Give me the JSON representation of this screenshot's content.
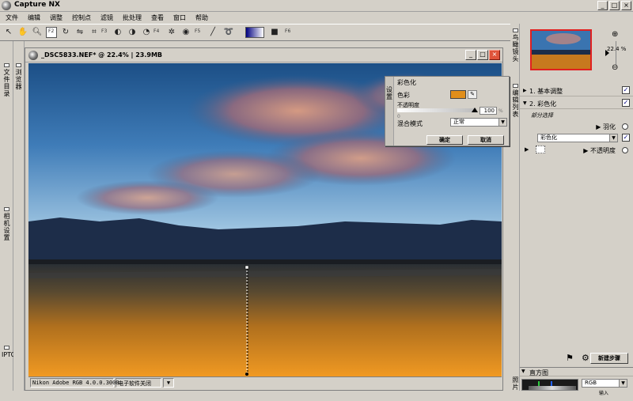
{
  "app": {
    "title": "Capture NX"
  },
  "window_buttons": [
    "_",
    "□",
    "×"
  ],
  "menu": [
    "文件",
    "编辑",
    "调整",
    "控制点",
    "滤镜",
    "批处理",
    "查看",
    "窗口",
    "帮助"
  ],
  "toolbar": {
    "fkeys": [
      "F2",
      "F3",
      "F4",
      "F5",
      "F6"
    ]
  },
  "left_rail": {
    "tabs": [
      {
        "label": "文件目录"
      },
      {
        "label": "相机设置"
      },
      {
        "label": "IPTC"
      }
    ],
    "browser_tab": "浏览器"
  },
  "document": {
    "title": "_DSC5833.NEF* @ 22.4% | 23.9MB",
    "status": {
      "profile": "Nikon Adobe RGB 4.0.0.3000",
      "softproof": "电子软件关闭"
    }
  },
  "dialog": {
    "side_label": "设置",
    "title": "彩色化",
    "color_label": "色彩",
    "color_value": "#e08e1b",
    "opacity_label": "不透明度",
    "opacity_min": "0",
    "opacity_value": "100",
    "opacity_unit": "%",
    "blend_label": "混合模式",
    "blend_value": "正常",
    "ok": "确定",
    "cancel": "取消"
  },
  "right_panel": {
    "birdseye_tab": "鸟瞰镜头",
    "edit_tab": "编辑列表",
    "histogram_tab": "照片",
    "zoom": "22.4 %",
    "steps": [
      {
        "label": "1. 基本调整",
        "checked": "✓"
      },
      {
        "label": "2. 彩色化",
        "checked": "✓"
      }
    ],
    "selection_label": "部分选择",
    "feather_label": "羽化",
    "effect_value": "彩色化",
    "effect_checked": "✓",
    "opacity_label": "不透明度",
    "new_step": "新建步骤",
    "histogram_label": "直方图",
    "histogram_channel": "RGB",
    "histogram_sub": "输入"
  },
  "colors": {
    "accent": "#e08e1b",
    "close": "#e0533a"
  }
}
